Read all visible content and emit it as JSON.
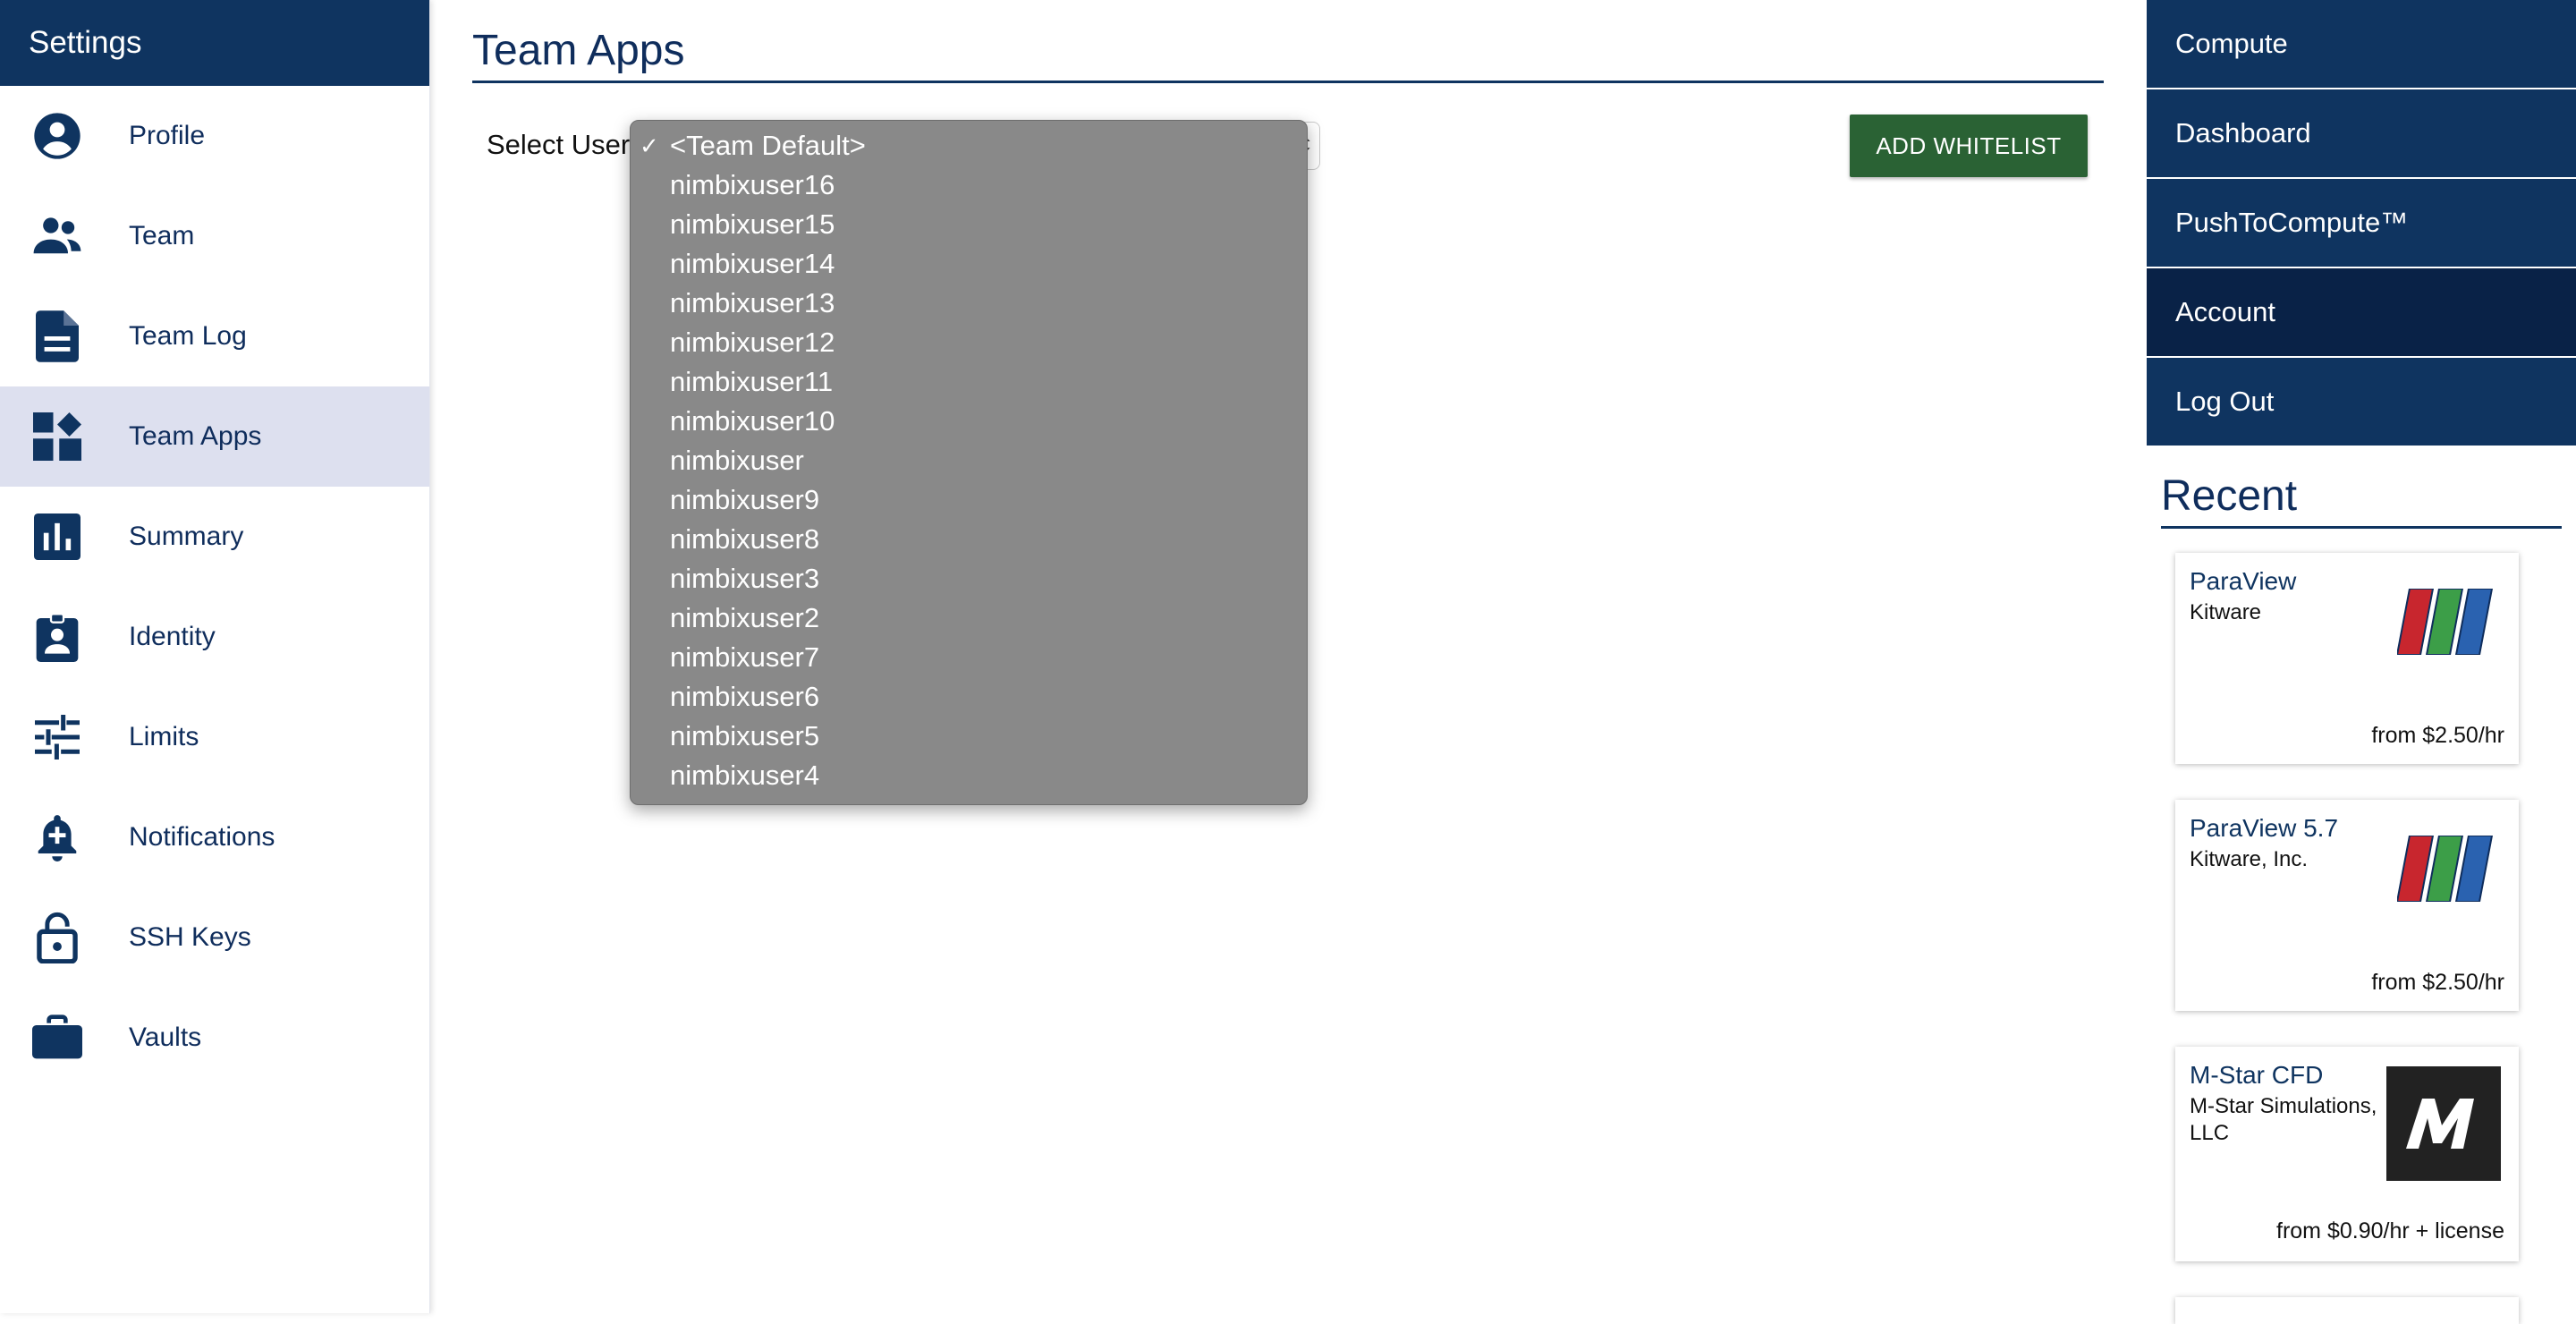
{
  "sidebar": {
    "title": "Settings",
    "items": [
      {
        "label": "Profile",
        "icon": "account-circle-icon"
      },
      {
        "label": "Team",
        "icon": "people-icon"
      },
      {
        "label": "Team Log",
        "icon": "document-icon"
      },
      {
        "label": "Team Apps",
        "icon": "widgets-icon",
        "active": true
      },
      {
        "label": "Summary",
        "icon": "bar-chart-icon"
      },
      {
        "label": "Identity",
        "icon": "badge-icon"
      },
      {
        "label": "Limits",
        "icon": "tune-icon"
      },
      {
        "label": "Notifications",
        "icon": "bell-plus-icon"
      },
      {
        "label": "SSH Keys",
        "icon": "lock-open-icon"
      },
      {
        "label": "Vaults",
        "icon": "briefcase-icon"
      }
    ]
  },
  "main": {
    "title": "Team Apps",
    "select_label": "Select User",
    "add_whitelist_label": "ADD WHITELIST",
    "dropdown": {
      "selected": "<Team Default>",
      "options": [
        "<Team Default>",
        "nimbixuser16",
        "nimbixuser15",
        "nimbixuser14",
        "nimbixuser13",
        "nimbixuser12",
        "nimbixuser11",
        "nimbixuser10",
        "nimbixuser",
        "nimbixuser9",
        "nimbixuser8",
        "nimbixuser3",
        "nimbixuser2",
        "nimbixuser7",
        "nimbixuser6",
        "nimbixuser5",
        "nimbixuser4"
      ]
    }
  },
  "right_nav": {
    "items": [
      {
        "label": "Compute"
      },
      {
        "label": "Dashboard"
      },
      {
        "label": "PushToCompute™"
      },
      {
        "label": "Account",
        "active": true
      },
      {
        "label": "Log Out"
      }
    ]
  },
  "recent": {
    "title": "Recent",
    "cards": [
      {
        "name": "ParaView",
        "vendor": "Kitware",
        "price": "from $2.50/hr",
        "logo": "paraview-logo"
      },
      {
        "name": "ParaView 5.7",
        "vendor": "Kitware, Inc.",
        "price": "from $2.50/hr",
        "logo": "paraview-logo"
      },
      {
        "name": "M-Star CFD",
        "vendor": "M-Star Simulations, LLC",
        "price": "from $0.90/hr + license",
        "logo": "mstar-logo"
      }
    ]
  },
  "colors": {
    "brand_navy": "#0f3460",
    "active_nav": "#092247",
    "sidebar_active": "#dde0ef",
    "button_green": "#2a6234",
    "dropdown_gray": "#898989"
  }
}
